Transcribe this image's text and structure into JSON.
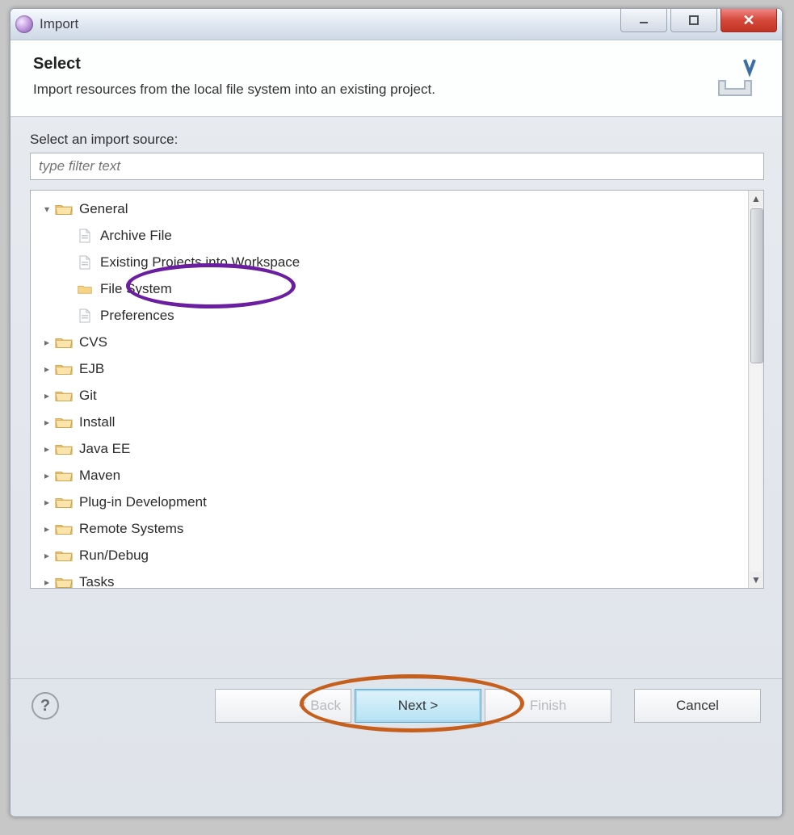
{
  "window": {
    "title": "Import"
  },
  "header": {
    "title": "Select",
    "description": "Import resources from the local file system into an existing project."
  },
  "body": {
    "source_label": "Select an import source:",
    "filter_placeholder": "type filter text"
  },
  "tree": {
    "root": {
      "label": "General",
      "expanded": true,
      "children": [
        {
          "label": "Archive File",
          "icon": "file-archive"
        },
        {
          "label": "Existing Projects into Workspace",
          "icon": "file-project"
        },
        {
          "label": "File System",
          "icon": "folder-leaf",
          "highlighted": true
        },
        {
          "label": "Preferences",
          "icon": "file-pref"
        }
      ]
    },
    "folders": [
      {
        "label": "CVS"
      },
      {
        "label": "EJB"
      },
      {
        "label": "Git"
      },
      {
        "label": "Install"
      },
      {
        "label": "Java EE"
      },
      {
        "label": "Maven"
      },
      {
        "label": "Plug-in Development"
      },
      {
        "label": "Remote Systems"
      },
      {
        "label": "Run/Debug"
      },
      {
        "label": "Tasks"
      }
    ]
  },
  "buttons": {
    "back": "< Back",
    "next": "Next >",
    "finish": "Finish",
    "cancel": "Cancel"
  }
}
